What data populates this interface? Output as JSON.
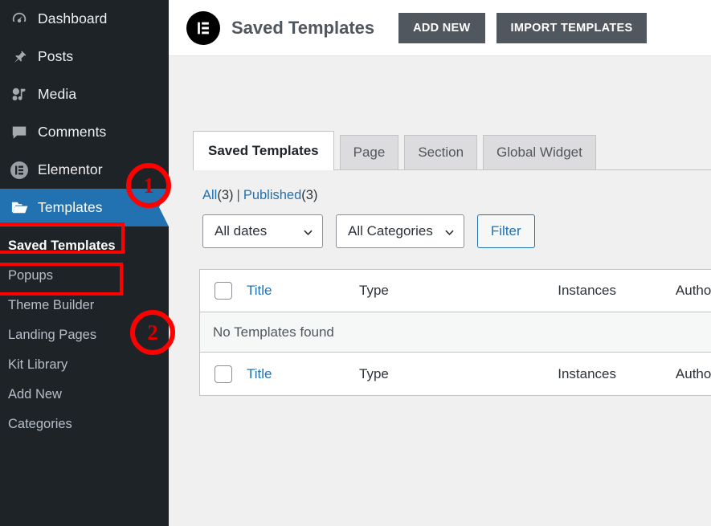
{
  "sidebar": {
    "items": [
      {
        "label": "Dashboard",
        "icon": "dashboard-icon",
        "name": "dashboard"
      },
      {
        "label": "Posts",
        "icon": "pin-icon",
        "name": "posts"
      },
      {
        "label": "Media",
        "icon": "media-icon",
        "name": "media"
      },
      {
        "label": "Comments",
        "icon": "comment-icon",
        "name": "comments"
      },
      {
        "label": "Elementor",
        "icon": "elementor-icon",
        "name": "elementor"
      },
      {
        "label": "Templates",
        "icon": "folder-icon",
        "name": "templates"
      }
    ],
    "submenu": [
      {
        "label": "Saved Templates",
        "current": true
      },
      {
        "label": "Popups",
        "current": false
      },
      {
        "label": "Theme Builder",
        "current": false
      },
      {
        "label": "Landing Pages",
        "current": false
      },
      {
        "label": "Kit Library",
        "current": false
      },
      {
        "label": "Add New",
        "current": false
      },
      {
        "label": "Categories",
        "current": false
      }
    ]
  },
  "annotations": [
    {
      "number": "1"
    },
    {
      "number": "2"
    }
  ],
  "header": {
    "logo": "elementor-logo",
    "title": "Saved Templates",
    "add_new_label": "ADD NEW",
    "import_label": "IMPORT TEMPLATES"
  },
  "tabs": [
    {
      "label": "Saved Templates",
      "active": true
    },
    {
      "label": "Page",
      "active": false
    },
    {
      "label": "Section",
      "active": false
    },
    {
      "label": "Global Widget",
      "active": false
    }
  ],
  "filters": {
    "all_label": "All",
    "all_count": "(3)",
    "separator": "|",
    "published_label": "Published",
    "published_count": "(3)",
    "dates_select": "All dates",
    "categories_select": "All Categories",
    "filter_button": "Filter"
  },
  "table": {
    "columns": {
      "title": "Title",
      "type": "Type",
      "instances": "Instances",
      "author": "Author"
    },
    "empty_message": "No Templates found"
  },
  "colors": {
    "sidebar_bg": "#1d2327",
    "active_blue": "#2271b1",
    "annotation_red": "#ff0000",
    "content_bg": "#f0f0f1",
    "button_gray": "#50575e"
  }
}
